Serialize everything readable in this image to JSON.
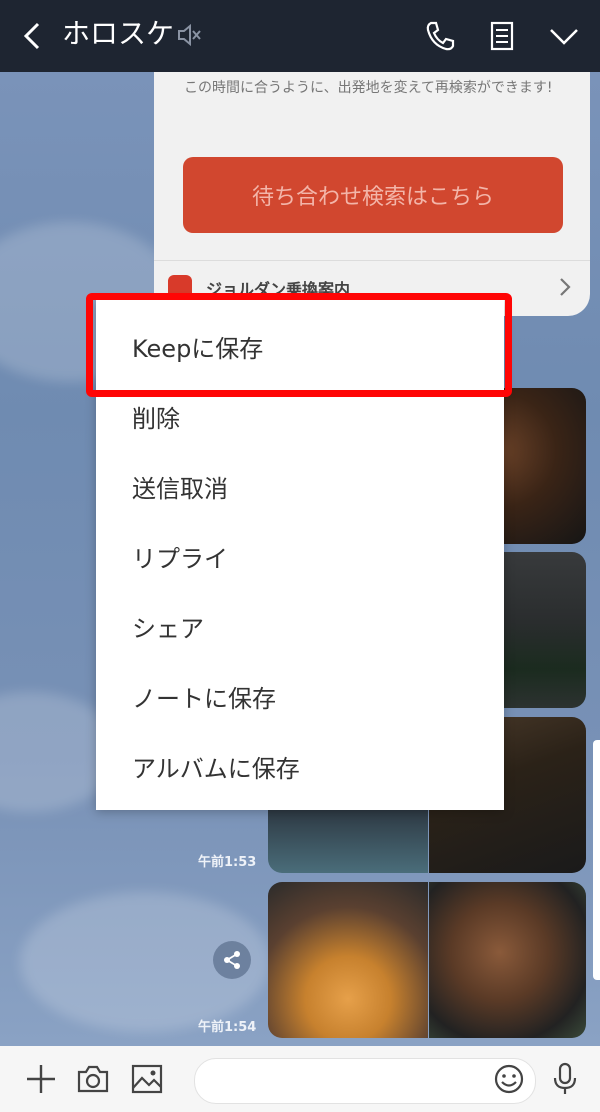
{
  "header": {
    "title": "ホロスケ",
    "bg_color": "#1e2531"
  },
  "card": {
    "description": "この時間に合うように、出発地を変えて再検索ができます!",
    "button_label": "待ち合わせ検索はこちら",
    "footer_label": "ジョルダン乗換案内",
    "button_color": "#d1472f"
  },
  "messages": [
    {
      "time": "午前1:53"
    },
    {
      "time": "午前1:54"
    }
  ],
  "menu": {
    "items": [
      {
        "label": "Keepに保存"
      },
      {
        "label": "削除"
      },
      {
        "label": "送信取消"
      },
      {
        "label": "リプライ"
      },
      {
        "label": "シェア"
      },
      {
        "label": "ノートに保存"
      },
      {
        "label": "アルバムに保存"
      }
    ],
    "highlight_color": "#ff0505"
  },
  "icons": {
    "back": "chevron-left-icon",
    "mute": "speaker-mute-icon",
    "call": "phone-icon",
    "notes": "note-icon",
    "more": "chevron-down-icon",
    "plus": "plus-icon",
    "camera": "camera-icon",
    "image": "image-icon",
    "emoji": "emoji-icon",
    "mic": "microphone-icon",
    "share": "share-icon"
  }
}
